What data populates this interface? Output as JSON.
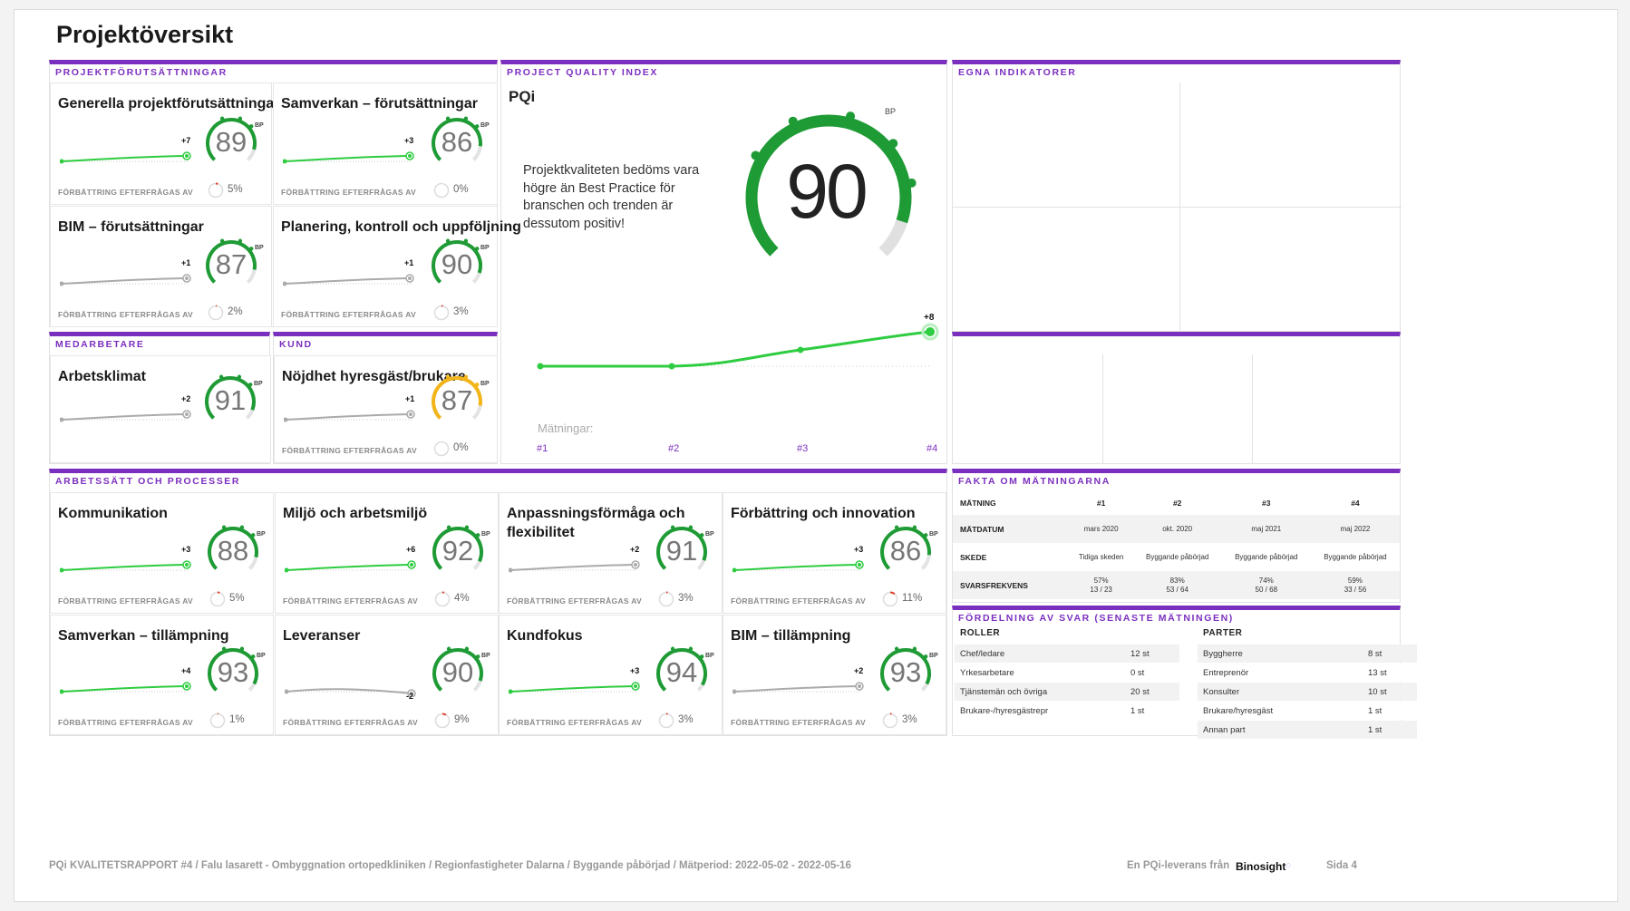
{
  "page_title": "Projektöversikt",
  "sections": {
    "projekt": "PROJEKTFÖRUTSÄTTNINGAR",
    "pqi": "PROJECT QUALITY INDEX",
    "egna": "EGNA INDIKATORER",
    "medarbetare": "MEDARBETARE",
    "kund": "KUND",
    "arbetssatt": "ARBETSSÄTT OCH PROCESSER",
    "fakta": "FAKTA OM MÄTNINGARNA",
    "fordelning": "FÖRDELNING AV SVAR (SENASTE MÄTNINGEN)"
  },
  "footer_label": "FÖRBÄTTRING EFTERFRÅGAS AV",
  "bp_label": "BP",
  "cards": [
    {
      "title": "Generella projektförutsättningar",
      "value": "89",
      "delta": "+7",
      "pct": "5%",
      "trend": "green",
      "pct_frac": 0.05
    },
    {
      "title": "Samverkan – förutsättningar",
      "value": "86",
      "delta": "+3",
      "pct": "0%",
      "trend": "green",
      "pct_frac": 0
    },
    {
      "title": "BIM – förutsättningar",
      "value": "87",
      "delta": "+1",
      "pct": "2%",
      "trend": "gray",
      "pct_frac": 0.02
    },
    {
      "title": "Planering, kontroll och uppföljning",
      "value": "90",
      "delta": "+1",
      "pct": "3%",
      "trend": "gray",
      "pct_frac": 0.03
    },
    {
      "title": "Arbetsklimat",
      "value": "91",
      "delta": "+2",
      "pct": "",
      "trend": "gray",
      "pct_frac": 0
    },
    {
      "title": "Nöjdhet hyresgäst/brukare",
      "value": "87",
      "delta": "+1",
      "pct": "0%",
      "trend": "gray",
      "pct_frac": 0,
      "gauge_color": "yellow"
    },
    {
      "title": "Kommunikation",
      "value": "88",
      "delta": "+3",
      "pct": "5%",
      "trend": "green",
      "pct_frac": 0.05
    },
    {
      "title": "Miljö och arbetsmiljö",
      "value": "92",
      "delta": "+6",
      "pct": "4%",
      "trend": "green",
      "pct_frac": 0.04
    },
    {
      "title": "Anpassningsförmåga och flexibilitet",
      "value": "91",
      "delta": "+2",
      "pct": "3%",
      "trend": "gray",
      "pct_frac": 0.03
    },
    {
      "title": "Förbättring och innovation",
      "value": "86",
      "delta": "+3",
      "pct": "11%",
      "trend": "green",
      "pct_frac": 0.11
    },
    {
      "title": "Samverkan – tillämpning",
      "value": "93",
      "delta": "+4",
      "pct": "1%",
      "trend": "green",
      "pct_frac": 0.01
    },
    {
      "title": "Leveranser",
      "value": "90",
      "delta": "-2",
      "pct": "9%",
      "trend": "gray",
      "pct_frac": 0.09
    },
    {
      "title": "Kundfokus",
      "value": "94",
      "delta": "+3",
      "pct": "3%",
      "trend": "green",
      "pct_frac": 0.03
    },
    {
      "title": "BIM – tillämpning",
      "value": "93",
      "delta": "+2",
      "pct": "3%",
      "trend": "gray",
      "pct_frac": 0.03
    }
  ],
  "pqi": {
    "label": "PQi",
    "value": "90",
    "text": "Projektkvaliteten bedöms vara högre än Best Practice för branschen och trenden är dessutom positiv!",
    "delta": "+8",
    "matningar_label": "Mätningar:",
    "x_labels": [
      "#1",
      "#2",
      "#3",
      "#4"
    ]
  },
  "fakta": {
    "head": [
      "MÄTNING",
      "#1",
      "#2",
      "#3",
      "#4"
    ],
    "rows": [
      {
        "label": "MÄTDATUM",
        "cells": [
          "mars 2020",
          "okt. 2020",
          "maj 2021",
          "maj 2022"
        ]
      },
      {
        "label": "SKEDE",
        "cells": [
          "Tidiga skeden",
          "Byggande påbörjad",
          "Byggande påbörjad",
          "Byggande påbörjad"
        ]
      },
      {
        "label": "SVARSFREKVENS",
        "cells": [
          "57%\n13 / 23",
          "83%\n53 / 64",
          "74%\n50 / 68",
          "59%\n33 / 56"
        ]
      }
    ]
  },
  "fordelning": {
    "roller_head": "ROLLER",
    "parter_head": "PARTER",
    "roller": [
      [
        "Chef/ledare",
        "12 st"
      ],
      [
        "Yrkesarbetare",
        "0 st"
      ],
      [
        "Tjänstemän och övriga",
        "20 st"
      ],
      [
        "Brukare-/hyresgästrepr",
        "1 st"
      ]
    ],
    "parter": [
      [
        "Byggherre",
        "8 st"
      ],
      [
        "Entreprenör",
        "13 st"
      ],
      [
        "Konsulter",
        "10 st"
      ],
      [
        "Brukare/hyresgäst",
        "1 st"
      ],
      [
        "Annan part",
        "1 st"
      ]
    ]
  },
  "footer": {
    "report": "PQi KVALITETSRAPPORT #4 / Falu lasarett - Ombyggnation ortopedkliniken / Regionfastigheter Dalarna / Byggande påbörjad / Mätperiod: 2022-05-02 - 2022-05-16",
    "delivery": "En PQi-leverans från",
    "brand": "Binosight",
    "page": "Sida  4"
  },
  "colors": {
    "accent": "#7b2fbf",
    "green": "#1e9b35",
    "lightgreen": "#2ecc40",
    "gray": "#aaaaaa",
    "yellow": "#f2b418"
  }
}
